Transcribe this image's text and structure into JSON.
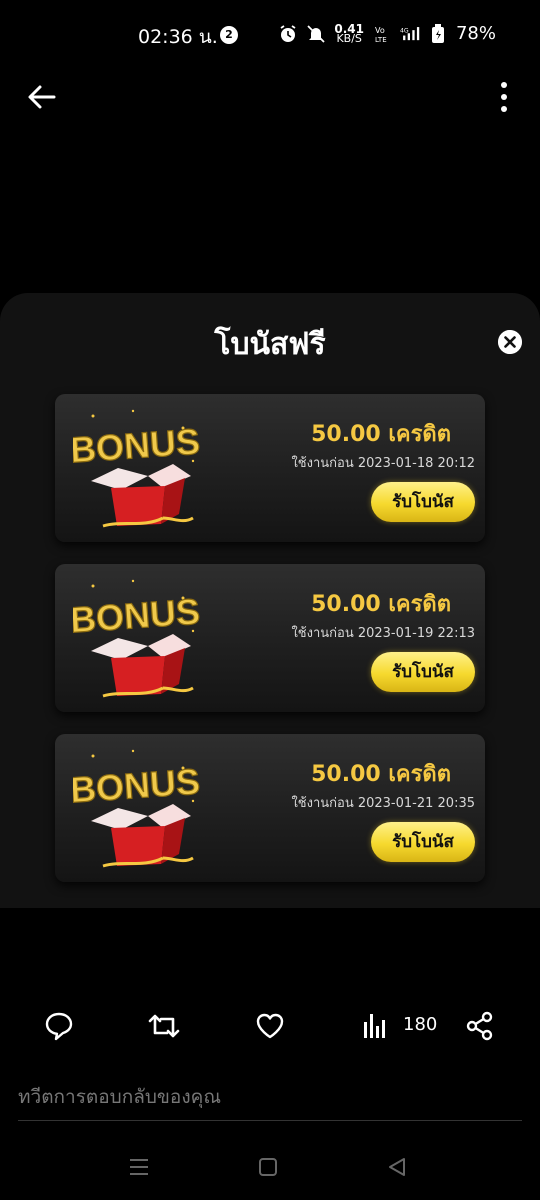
{
  "status_bar": {
    "time": "02:36 น.",
    "notification_count": "2",
    "net_speed_value": "0.41",
    "net_speed_unit": "KB/S",
    "battery": "78%"
  },
  "modal": {
    "title": "โบนัสฟรี",
    "cards": [
      {
        "art_text": "BONUS",
        "credit": "50.00 เครดิต",
        "expiry": "ใช้งานก่อน 2023-01-18 20:12",
        "claim_label": "รับโบนัส"
      },
      {
        "art_text": "BONUS",
        "credit": "50.00 เครดิต",
        "expiry": "ใช้งานก่อน 2023-01-19 22:13",
        "claim_label": "รับโบนัส"
      },
      {
        "art_text": "BONUS",
        "credit": "50.00 เครดิต",
        "expiry": "ใช้งานก่อน 2023-01-21 20:35",
        "claim_label": "รับโบนัส"
      }
    ]
  },
  "actions": {
    "view_count": "180",
    "icons": [
      "reply-icon",
      "retweet-icon",
      "like-icon",
      "views-icon",
      "share-icon"
    ]
  },
  "reply": {
    "placeholder": "ทวีตการตอบกลับของคุณ"
  },
  "colors": {
    "accent_gold": "#f5c842",
    "button_yellow": "#f6d92e",
    "card_bg": "#2a2a2a"
  }
}
